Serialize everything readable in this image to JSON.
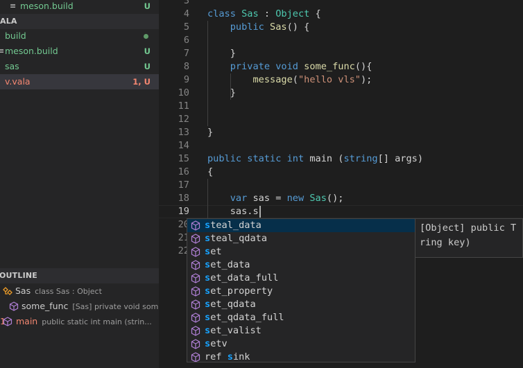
{
  "explorer": {
    "items": [
      {
        "icon": "≡",
        "name": "meson.build",
        "badge": "U",
        "badge_color": "green"
      },
      {
        "section": "ALA"
      },
      {
        "name": "build",
        "badge": "dot",
        "badge_color": "green"
      },
      {
        "icon": "≡",
        "name": "meson.build",
        "badge": "U",
        "badge_color": "green"
      },
      {
        "name": "sas",
        "badge": "U",
        "badge_color": "green"
      },
      {
        "name": "v.vala",
        "badge": "1, U",
        "badge_color": "red",
        "selected": true
      }
    ]
  },
  "outline": {
    "title": "OUTLINE",
    "items": [
      {
        "name": "Sas",
        "detail": "class Sas : Object",
        "icon": "class-icon",
        "color": "#cccccc"
      },
      {
        "name": "some_func",
        "detail": "[Sas] private void som...",
        "icon": "method-icon",
        "color": "#cccccc"
      },
      {
        "name": "main",
        "detail": "public static int main (strin...",
        "icon": "method-icon",
        "color": "#f48771",
        "badge": "1"
      }
    ]
  },
  "editor": {
    "lines": [
      {
        "n": "3"
      },
      {
        "n": "4"
      },
      {
        "n": "5"
      },
      {
        "n": "6"
      },
      {
        "n": "7"
      },
      {
        "n": "8"
      },
      {
        "n": "9"
      },
      {
        "n": "10"
      },
      {
        "n": "11"
      },
      {
        "n": "12"
      },
      {
        "n": "13"
      },
      {
        "n": "14"
      },
      {
        "n": "15"
      },
      {
        "n": "16"
      },
      {
        "n": "17"
      },
      {
        "n": "18"
      },
      {
        "n": "19"
      },
      {
        "n": "20"
      },
      {
        "n": "21"
      },
      {
        "n": "22"
      }
    ],
    "code": {
      "l4_a": "class ",
      "l4_b": "Sas",
      "l4_c": " : ",
      "l4_d": "Object",
      "l4_e": " {",
      "l5_a": "    ",
      "l5_b": "public",
      "l5_c": " ",
      "l5_d": "Sas",
      "l5_e": "() {",
      "l7": "    }",
      "l8_a": "    ",
      "l8_b": "private",
      "l8_c": " ",
      "l8_d": "void",
      "l8_e": " ",
      "l8_f": "some_func",
      "l8_g": "(){",
      "l9_a": "        ",
      "l9_b": "message",
      "l9_c": "(",
      "l9_d": "\"hello vls\"",
      "l9_e": ");",
      "l10": "    }",
      "l13": "}",
      "l15_a": "public",
      "l15_b": " ",
      "l15_c": "static",
      "l15_d": " ",
      "l15_e": "int",
      "l15_f": " main (",
      "l15_g": "string",
      "l15_h": "[] args)",
      "l16": "{",
      "l18_a": "    ",
      "l18_b": "var",
      "l18_c": " sas = ",
      "l18_d": "new",
      "l18_e": " ",
      "l18_f": "Sas",
      "l18_g": "();",
      "l19": "    sas.s"
    }
  },
  "suggest": {
    "items": [
      {
        "match": "s",
        "rest": "teal_data",
        "prefix": "",
        "focused": true
      },
      {
        "match": "s",
        "rest": "teal_qdata",
        "prefix": ""
      },
      {
        "match": "s",
        "rest": "et",
        "prefix": ""
      },
      {
        "match": "s",
        "rest": "et_data",
        "prefix": ""
      },
      {
        "match": "s",
        "rest": "et_data_full",
        "prefix": ""
      },
      {
        "match": "s",
        "rest": "et_property",
        "prefix": ""
      },
      {
        "match": "s",
        "rest": "et_qdata",
        "prefix": ""
      },
      {
        "match": "s",
        "rest": "et_qdata_full",
        "prefix": ""
      },
      {
        "match": "s",
        "rest": "et_valist",
        "prefix": ""
      },
      {
        "match": "s",
        "rest": "etv",
        "prefix": ""
      },
      {
        "match": "s",
        "rest": "ink",
        "prefix": "ref "
      }
    ],
    "detail": "[Object] public T\nring key)"
  },
  "colors": {
    "accent": "#18a3ff",
    "untracked": "#73c991",
    "error": "#f48771",
    "cube_icon": "#b180d7",
    "class_icon": "#ee9d28"
  }
}
